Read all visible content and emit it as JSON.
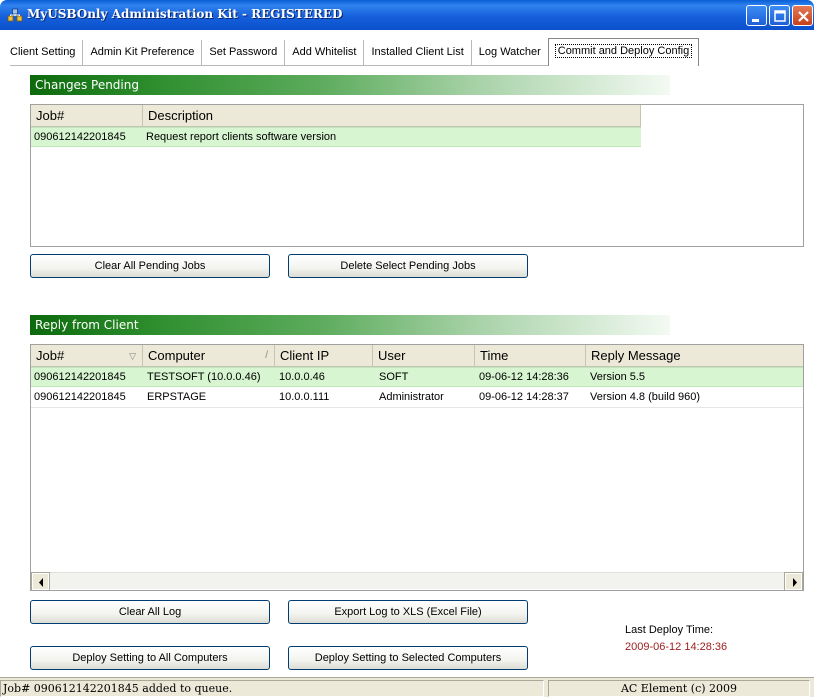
{
  "window": {
    "title": "MyUSBOnly Administration Kit - REGISTERED",
    "icons": [
      "app-icon",
      "minimize-icon",
      "maximize-icon",
      "close-icon"
    ]
  },
  "tabs": [
    {
      "label": "Client Setting"
    },
    {
      "label": "Admin Kit Preference"
    },
    {
      "label": "Set Password"
    },
    {
      "label": "Add Whitelist"
    },
    {
      "label": "Installed Client List"
    },
    {
      "label": "Log Watcher"
    },
    {
      "label": "Commit and Deploy Config",
      "active": true
    }
  ],
  "pending": {
    "title": "Changes Pending",
    "columns": [
      "Job#",
      "Description"
    ],
    "rows": [
      {
        "job": "090612142201845",
        "description": "Request report clients software version"
      }
    ],
    "clear_button": "Clear All Pending Jobs",
    "delete_button": "Delete Select Pending Jobs"
  },
  "replies": {
    "title": "Reply from Client",
    "columns": [
      "Job#",
      "Computer",
      "Client IP",
      "User",
      "Time",
      "Reply Message"
    ],
    "rows": [
      {
        "job": "090612142201845",
        "computer": "TESTSOFT (10.0.0.46)",
        "ip": "10.0.0.46",
        "user": "SOFT",
        "time": "09-06-12 14:28:36",
        "message": "Version 5.5"
      },
      {
        "job": "090612142201845",
        "computer": "ERPSTAGE",
        "ip": "10.0.0.111",
        "user": "Administrator",
        "time": "09-06-12 14:28:37",
        "message": "Version 4.8 (build 960)"
      }
    ],
    "clear_log_button": "Clear All Log",
    "export_button": "Export Log to XLS (Excel File)",
    "deploy_all_button": "Deploy Setting to All Computers",
    "deploy_selected_button": "Deploy Setting to Selected Computers"
  },
  "deploy": {
    "label": "Last Deploy Time:",
    "time": "2009-06-12 14:28:36"
  },
  "status": {
    "message": "Job# 090612142201845 added to queue.",
    "copyright": "AC Element (c) 2009"
  },
  "colors": {
    "title_bar": "#1660dc",
    "section_green": "#2f8f2f",
    "selected_row": "#d6f5d0",
    "deploy_time": "#a02020"
  }
}
